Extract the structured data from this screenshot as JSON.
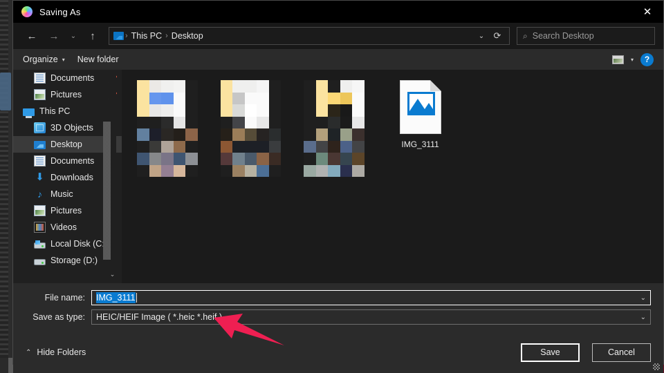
{
  "window": {
    "title": "Saving As",
    "app_icon": "photos-app-icon",
    "close_label": "✕"
  },
  "nav": {
    "back_icon": "arrow-left-icon",
    "forward_icon": "arrow-right-icon",
    "recent_icon": "chevron-down-icon",
    "up_icon": "arrow-up-icon",
    "breadcrumb_icon": "this-pc-icon",
    "breadcrumbs": [
      "This PC",
      "Desktop"
    ],
    "separator": "›",
    "dropdown_icon": "chevron-down-icon",
    "refresh_icon": "refresh-icon",
    "search": {
      "icon": "search-icon",
      "placeholder": "Search Desktop",
      "value": ""
    }
  },
  "commandbar": {
    "organize": "Organize",
    "organize_caret": "▾",
    "new_folder": "New folder",
    "view_icon": "view-options-icon",
    "view_caret": "▾",
    "help": "?"
  },
  "sidebar": {
    "scroll_up_icon": "chevron-up-icon",
    "scroll_down_icon": "chevron-down-icon",
    "items": [
      {
        "label": "Documents",
        "icon": "document-icon",
        "pinned": true,
        "pin_glyph": "📌",
        "selected": false,
        "indent": 1
      },
      {
        "label": "Pictures",
        "icon": "pictures-icon",
        "pinned": true,
        "pin_glyph": "📌",
        "selected": false,
        "indent": 1
      },
      {
        "label": "This PC",
        "icon": "this-pc-icon",
        "pinned": false,
        "pin_glyph": "",
        "selected": false,
        "indent": 0
      },
      {
        "label": "3D Objects",
        "icon": "3d-objects-icon",
        "pinned": false,
        "pin_glyph": "",
        "selected": false,
        "indent": 1
      },
      {
        "label": "Desktop",
        "icon": "desktop-icon",
        "pinned": false,
        "pin_glyph": "",
        "selected": true,
        "indent": 1
      },
      {
        "label": "Documents",
        "icon": "document-icon",
        "pinned": false,
        "pin_glyph": "",
        "selected": false,
        "indent": 1
      },
      {
        "label": "Downloads",
        "icon": "downloads-icon",
        "pinned": false,
        "pin_glyph": "",
        "selected": false,
        "indent": 1
      },
      {
        "label": "Music",
        "icon": "music-icon",
        "pinned": false,
        "pin_glyph": "",
        "selected": false,
        "indent": 1
      },
      {
        "label": "Pictures",
        "icon": "pictures-icon",
        "pinned": false,
        "pin_glyph": "",
        "selected": false,
        "indent": 1
      },
      {
        "label": "Videos",
        "icon": "videos-icon",
        "pinned": false,
        "pin_glyph": "",
        "selected": false,
        "indent": 1
      },
      {
        "label": "Local Disk (C:)",
        "icon": "local-disk-icon",
        "pinned": false,
        "pin_glyph": "",
        "selected": false,
        "indent": 1
      },
      {
        "label": "Storage (D:)",
        "icon": "drive-icon",
        "pinned": false,
        "pin_glyph": "",
        "selected": false,
        "indent": 1
      }
    ]
  },
  "files": {
    "blurred_thumbnails": [
      {
        "name": "redacted-thumbnail-1",
        "cells": [
          "#fbe3a0",
          "#ebe9e6",
          "#f0f0ef",
          "#f3f3f2",
          "#1f1f1f",
          "#fbe3a0",
          "#6596ee",
          "#5f92ec",
          "#fafafa",
          "#1f1f1f",
          "#fbe3a0",
          "#e7e7e7",
          "#eeeeed",
          "#fafafa",
          "#1f1f1f",
          "#1f1f1f",
          "#1f1f1f",
          "#2b2b2b",
          "#e5e5e5",
          "#1f1f1f",
          "#62809f",
          "#1d1f2a",
          "#2a2724",
          "#241f1a",
          "#8d6448",
          "#1f1f1f",
          "#3a3a38",
          "#afa398",
          "#8e6a4b",
          "#1f1f1f",
          "#3f5571",
          "#86888a",
          "#7a7487",
          "#3f5571",
          "#8d9095",
          "#1f1f1f",
          "#c0a487",
          "#947f93",
          "#d6b79c",
          "#1f1f1f"
        ]
      },
      {
        "name": "redacted-thumbnail-2",
        "cells": [
          "#fbe3a0",
          "#efefee",
          "#efefee",
          "#f5f5f5",
          "#1f1f1f",
          "#fbe3a0",
          "#c6c6c6",
          "#fafafa",
          "#fafafa",
          "#1f1f1f",
          "#fbe3a0",
          "#d9dad8",
          "#ffffff",
          "#fafafa",
          "#1f1f1f",
          "#1f1f1f",
          "#434448",
          "#fafafa",
          "#e7e7e7",
          "#1f1f1f",
          "#262019",
          "#9b7d58",
          "#564c38",
          "#262322",
          "#2a2d2e",
          "#8c5733",
          "#1d2026",
          "#1d2026",
          "#1d2026",
          "#3a3c3e",
          "#55393a",
          "#70808c",
          "#4a5a6b",
          "#8a6346",
          "#3a2b24",
          "#1f1f1f",
          "#9b8162",
          "#b7b2a2",
          "#4c6f96",
          "#1f1f1f"
        ]
      },
      {
        "name": "redacted-thumbnail-3",
        "cells": [
          "#1f1f1f",
          "#fbe3a0",
          "#1f1f1f",
          "#efefee",
          "#f6f6f6",
          "#1f1f1f",
          "#fbe3a0",
          "#fcd876",
          "#edc65a",
          "#fafafa",
          "#1f1f1f",
          "#fbe3a0",
          "#2b2519",
          "#191919",
          "#fafafa",
          "#1f1f1f",
          "#1f1f1f",
          "#2a2c2c",
          "#1b1b1b",
          "#e7e7e7",
          "#1f1f1f",
          "#b3a07c",
          "#1f2326",
          "#99a089",
          "#3b302d",
          "#5a6d8c",
          "#434446",
          "#2e231c",
          "#4c6188",
          "#434446",
          "#1f1f1f",
          "#6c8a7c",
          "#4a3733",
          "#36454f",
          "#5c4529",
          "#9aa9a2",
          "#b0b2b1",
          "#83aabd",
          "#2a2f4d",
          "#adaaa4"
        ]
      }
    ],
    "items": [
      {
        "name": "IMG_3111",
        "icon": "image-file-icon"
      }
    ]
  },
  "form": {
    "filename_label": "File name:",
    "filename_value": "IMG_3111",
    "filename_selected": true,
    "savetype_label": "Save as type:",
    "savetype_value": "HEIC/HEIF Image ( *.heic *.heif )",
    "dropdown_icon": "chevron-down-icon"
  },
  "footer": {
    "hide_folders": "Hide Folders",
    "hide_folders_icon": "chevron-up-icon",
    "save": "Save",
    "cancel": "Cancel",
    "resize_grip": "resize-grip"
  },
  "annotation": {
    "arrow": "red-pointer-arrow",
    "color": "#ef1f52"
  },
  "colors": {
    "accent": "#0a7bd0",
    "selection": "#0a7bd0",
    "dialog_bg": "#2b2b2b",
    "content_bg": "#1b1b1b",
    "titlebar_bg": "#000000"
  }
}
